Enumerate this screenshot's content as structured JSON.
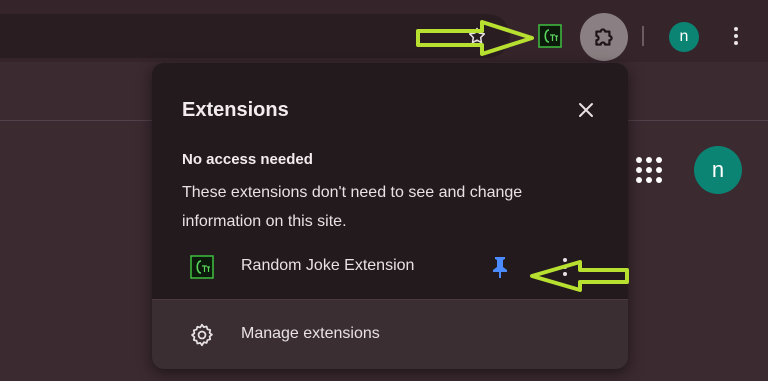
{
  "popup": {
    "title": "Extensions",
    "section_heading": "No access needed",
    "section_description": "These extensions don't need to see and change information on this site.",
    "extensions": [
      {
        "name": "Random Joke Extension",
        "pinned": true
      }
    ],
    "manage_label": "Manage extensions"
  },
  "profile": {
    "initial": "n"
  },
  "colors": {
    "accent_pin": "#4a8cff",
    "avatar": "#0b8474",
    "annotation_arrow": "#b8e030"
  },
  "icons": [
    "star-icon",
    "extension-icon",
    "puzzle-icon",
    "close-icon",
    "pin-icon",
    "gear-icon",
    "apps-grid-icon",
    "more-vert-icon"
  ]
}
